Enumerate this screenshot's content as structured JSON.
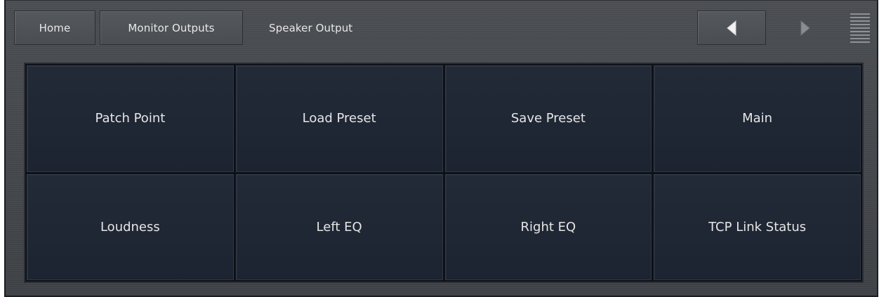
{
  "breadcrumb": {
    "home": "Home",
    "monitor_outputs": "Monitor Outputs",
    "current": "Speaker Output"
  },
  "nav": {
    "prev_icon": "triangle-left-icon",
    "next_icon": "triangle-right-icon",
    "menu_icon": "menu-lines-icon"
  },
  "tiles": [
    {
      "label": "Patch Point"
    },
    {
      "label": "Load Preset"
    },
    {
      "label": "Save Preset"
    },
    {
      "label": "Main"
    },
    {
      "label": "Loudness"
    },
    {
      "label": "Left EQ"
    },
    {
      "label": "Right EQ"
    },
    {
      "label": "TCP Link Status"
    }
  ],
  "colors": {
    "frame_bg": "#45484c",
    "tile_bg": "#202836",
    "text": "#e6e6e6",
    "disabled_arrow": "#7a7d82"
  }
}
